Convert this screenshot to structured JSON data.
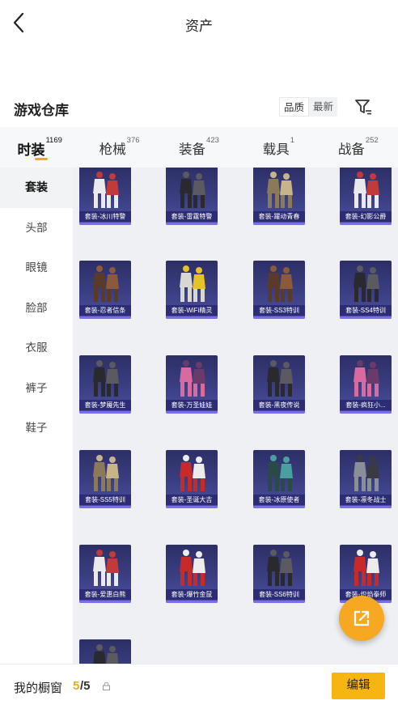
{
  "nav": {
    "title": "资产",
    "back_icon": "back-arrow-icon"
  },
  "warehouse": {
    "title": "游戏仓库",
    "sort_options": [
      {
        "label": "品质",
        "active": true
      },
      {
        "label": "最新",
        "active": false
      }
    ],
    "filter_icon": "filter-icon"
  },
  "tabs": [
    {
      "label": "时装",
      "count": "1169",
      "active": true
    },
    {
      "label": "枪械",
      "count": "376",
      "active": false
    },
    {
      "label": "装备",
      "count": "423",
      "active": false
    },
    {
      "label": "载具",
      "count": "1",
      "active": false
    },
    {
      "label": "战备",
      "count": "252",
      "active": false
    }
  ],
  "sidebar": [
    {
      "label": "套装",
      "active": true
    },
    {
      "label": "头部",
      "active": false
    },
    {
      "label": "眼镜",
      "active": false
    },
    {
      "label": "脸部",
      "active": false
    },
    {
      "label": "衣服",
      "active": false
    },
    {
      "label": "裤子",
      "active": false
    },
    {
      "label": "鞋子",
      "active": false
    }
  ],
  "items": [
    {
      "label": "套装-冰川特警",
      "palette": "white"
    },
    {
      "label": "套装-雷霆特警",
      "palette": "dark"
    },
    {
      "label": "套装-躍动青春",
      "palette": "beige"
    },
    {
      "label": "套装-幻影公爵",
      "palette": "white"
    },
    {
      "label": "套装-忍者信条",
      "palette": "brown"
    },
    {
      "label": "套装-WiFi精灵",
      "palette": "yellow"
    },
    {
      "label": "套装-SS3特训",
      "palette": "brown"
    },
    {
      "label": "套装-SS4特训",
      "palette": "dark"
    },
    {
      "label": "套装-梦魇先生",
      "palette": "dark"
    },
    {
      "label": "套装-万圣娃娃",
      "palette": "pink"
    },
    {
      "label": "套装-黑夜传说",
      "palette": "dark"
    },
    {
      "label": "套装-疯狂小...",
      "palette": "pink"
    },
    {
      "label": "套装-SS5特训",
      "palette": "beige"
    },
    {
      "label": "套装-圣诞大吉",
      "palette": "red"
    },
    {
      "label": "套装-冰原使者",
      "palette": "teal"
    },
    {
      "label": "套装-凛冬战士",
      "palette": "grey"
    },
    {
      "label": "套装-爱惠白熊",
      "palette": "white"
    },
    {
      "label": "套装-爆竹金鼠",
      "palette": "red"
    },
    {
      "label": "套装-SS6特训",
      "palette": "dark"
    },
    {
      "label": "套装-炽焰拳师",
      "palette": "red"
    },
    {
      "label": "",
      "palette": "dark"
    }
  ],
  "float_button_icon": "share-external-icon",
  "bottom_bar": {
    "label": "我的橱窗",
    "current": "5",
    "total": "/5",
    "lock_icon": "lock-icon",
    "edit_label": "编辑"
  },
  "colors": {
    "accent": "#f5a623",
    "card_bg": "#3b3f82",
    "card_stripe": "#7b6cf0",
    "edit_button": "#f7b512"
  }
}
